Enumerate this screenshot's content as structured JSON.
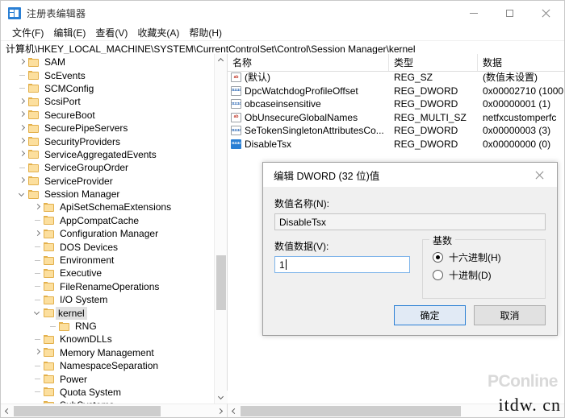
{
  "window": {
    "title": "注册表编辑器",
    "icon": "registry-editor-icon",
    "minimize_label": "最小化",
    "maximize_label": "最大化",
    "close_label": "关闭"
  },
  "menubar": {
    "items": [
      {
        "label": "文件(F)"
      },
      {
        "label": "编辑(E)"
      },
      {
        "label": "查看(V)"
      },
      {
        "label": "收藏夹(A)"
      },
      {
        "label": "帮助(H)"
      }
    ]
  },
  "address": {
    "path": "计算机\\HKEY_LOCAL_MACHINE\\SYSTEM\\CurrentControlSet\\Control\\Session Manager\\kernel"
  },
  "tree": {
    "nodes": [
      {
        "label": "SAM",
        "indent": 0,
        "twist": "collapsed",
        "selected": false
      },
      {
        "label": "ScEvents",
        "indent": 0,
        "twist": "none",
        "selected": false
      },
      {
        "label": "SCMConfig",
        "indent": 0,
        "twist": "none",
        "selected": false
      },
      {
        "label": "ScsiPort",
        "indent": 0,
        "twist": "collapsed",
        "selected": false
      },
      {
        "label": "SecureBoot",
        "indent": 0,
        "twist": "collapsed",
        "selected": false
      },
      {
        "label": "SecurePipeServers",
        "indent": 0,
        "twist": "collapsed",
        "selected": false
      },
      {
        "label": "SecurityProviders",
        "indent": 0,
        "twist": "collapsed",
        "selected": false
      },
      {
        "label": "ServiceAggregatedEvents",
        "indent": 0,
        "twist": "collapsed",
        "selected": false
      },
      {
        "label": "ServiceGroupOrder",
        "indent": 0,
        "twist": "none",
        "selected": false
      },
      {
        "label": "ServiceProvider",
        "indent": 0,
        "twist": "collapsed",
        "selected": false
      },
      {
        "label": "Session Manager",
        "indent": 0,
        "twist": "expanded",
        "selected": false
      },
      {
        "label": "ApiSetSchemaExtensions",
        "indent": 1,
        "twist": "collapsed",
        "selected": false
      },
      {
        "label": "AppCompatCache",
        "indent": 1,
        "twist": "none",
        "selected": false
      },
      {
        "label": "Configuration Manager",
        "indent": 1,
        "twist": "collapsed",
        "selected": false
      },
      {
        "label": "DOS Devices",
        "indent": 1,
        "twist": "none",
        "selected": false
      },
      {
        "label": "Environment",
        "indent": 1,
        "twist": "none",
        "selected": false
      },
      {
        "label": "Executive",
        "indent": 1,
        "twist": "none",
        "selected": false
      },
      {
        "label": "FileRenameOperations",
        "indent": 1,
        "twist": "none",
        "selected": false
      },
      {
        "label": "I/O System",
        "indent": 1,
        "twist": "none",
        "selected": false
      },
      {
        "label": "kernel",
        "indent": 1,
        "twist": "expanded",
        "selected": true
      },
      {
        "label": "RNG",
        "indent": 2,
        "twist": "none",
        "selected": false
      },
      {
        "label": "KnownDLLs",
        "indent": 1,
        "twist": "none",
        "selected": false
      },
      {
        "label": "Memory Management",
        "indent": 1,
        "twist": "collapsed",
        "selected": false
      },
      {
        "label": "NamespaceSeparation",
        "indent": 1,
        "twist": "none",
        "selected": false
      },
      {
        "label": "Power",
        "indent": 1,
        "twist": "none",
        "selected": false
      },
      {
        "label": "Quota System",
        "indent": 1,
        "twist": "none",
        "selected": false
      },
      {
        "label": "SubSystems",
        "indent": 1,
        "twist": "none",
        "selected": false
      }
    ]
  },
  "list": {
    "columns": [
      {
        "label": "名称"
      },
      {
        "label": "类型"
      },
      {
        "label": "数据"
      }
    ],
    "rows": [
      {
        "name": "(默认)",
        "type": "REG_SZ",
        "data": "(数值未设置)",
        "icon": "string-value-icon",
        "selected": false
      },
      {
        "name": "DpcWatchdogProfileOffset",
        "type": "REG_DWORD",
        "data": "0x00002710 (1000",
        "icon": "dword-value-icon",
        "selected": false
      },
      {
        "name": "obcaseinsensitive",
        "type": "REG_DWORD",
        "data": "0x00000001 (1)",
        "icon": "dword-value-icon",
        "selected": false
      },
      {
        "name": "ObUnsecureGlobalNames",
        "type": "REG_MULTI_SZ",
        "data": "netfxcustomperfc",
        "icon": "string-value-icon",
        "selected": false
      },
      {
        "name": "SeTokenSingletonAttributesCo...",
        "type": "REG_DWORD",
        "data": "0x00000003 (3)",
        "icon": "dword-value-icon",
        "selected": false
      },
      {
        "name": "DisableTsx",
        "type": "REG_DWORD",
        "data": "0x00000000 (0)",
        "icon": "dword-value-icon",
        "selected": true
      }
    ]
  },
  "dialog": {
    "title": "编辑 DWORD (32 位)值",
    "close_label": "关闭",
    "name_label": "数值名称(N):",
    "name_value": "DisableTsx",
    "data_label": "数值数据(V):",
    "data_value": "1",
    "base_legend": "基数",
    "base_options": [
      {
        "label": "十六进制(H)",
        "selected": true
      },
      {
        "label": "十进制(D)",
        "selected": false
      }
    ],
    "ok_label": "确定",
    "cancel_label": "取消"
  },
  "watermark": {
    "primary": "PConline",
    "secondary": "itdw. cn"
  },
  "icons": {
    "string_value_glyph": "ab",
    "dword_value_glyph_top": "011",
    "dword_value_glyph_bottom": "110"
  },
  "colors": {
    "accent": "#2a7fd4",
    "selection": "#e0e0e0",
    "dialog_bg": "#f0f0f0",
    "string_icon": "#c0392b",
    "dword_icon": "#1f5fb0"
  }
}
